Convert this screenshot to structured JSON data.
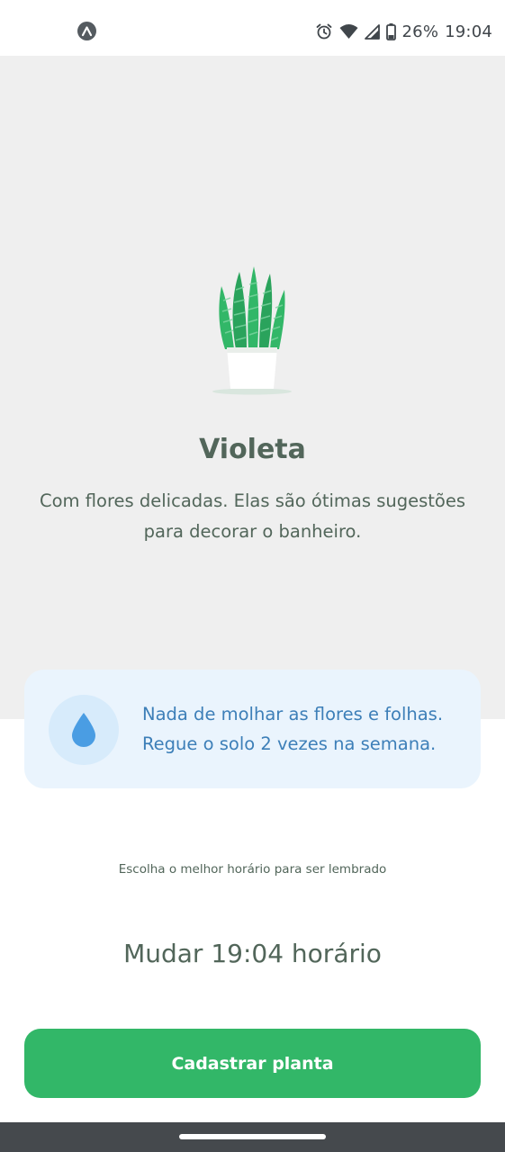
{
  "status_bar": {
    "app_icon": "expo-icon",
    "icons": [
      "alarm-icon",
      "wifi-icon",
      "signal-icon",
      "battery-icon"
    ],
    "battery": "26%",
    "time": "19:04"
  },
  "plant": {
    "illustration": "snake-plant-in-pot",
    "name": "Violeta",
    "about": "Com flores delicadas. Elas são ótimas sugestões para decorar o banheiro."
  },
  "tip": {
    "icon": "water-drop-icon",
    "text": "Nada de molhar as flores e folhas. Regue o solo 2 vezes na semana."
  },
  "reminder": {
    "label": "Escolha o melhor horário para ser lembrado",
    "change_time_label": "Mudar 19:04 horário"
  },
  "submit_button": {
    "label": "Cadastrar planta"
  },
  "colors": {
    "hero_bg": "#efefef",
    "heading": "#52665a",
    "tip_bg": "#eaf4fd",
    "tip_text": "#3d7fb8",
    "green": "#32b768",
    "nav_bar": "#45494d"
  }
}
